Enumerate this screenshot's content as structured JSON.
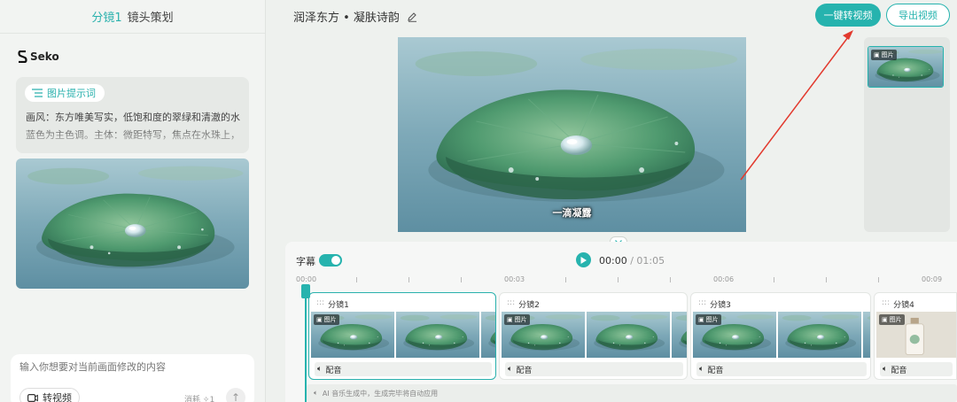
{
  "left_panel": {
    "header_accent": "分镜1",
    "header_title": "镜头策划",
    "brand_name": "Seko",
    "prompt_tag": "图片提示词",
    "prompt_text": "画风：东方唯美写实，低饱和度的翠绿和清澈的水蓝色为主色调。主体：微距特写，焦点在水珠上，悬荧",
    "input_placeholder": "输入你想要对当前画面修改的内容",
    "video_button": "转视频",
    "cost_label": "消耗",
    "cost_value": "1"
  },
  "header": {
    "title": "润泽东方 • 凝肤诗韵",
    "primary_button": "一键转视频",
    "secondary_button": "导出视频"
  },
  "preview": {
    "subtitle": "一滴凝露",
    "thumb_badge": "图片"
  },
  "timeline": {
    "subtitle_label": "字幕",
    "current_time": "00:00",
    "separator": "/",
    "total_time": "01:05",
    "ruler_labels": [
      "00:00",
      "00:03",
      "00:06",
      "00:09"
    ],
    "clips": [
      {
        "label": "分镜1",
        "badge": "图片",
        "audio": "配音"
      },
      {
        "label": "分镜2",
        "badge": "图片",
        "audio": "配音"
      },
      {
        "label": "分镜3",
        "badge": "图片",
        "audio": "配音"
      },
      {
        "label": "分镜4",
        "badge": "图片",
        "audio": "配音"
      }
    ],
    "music_text": "AI 音乐生成中，生成完毕将自动应用"
  },
  "colors": {
    "accent": "#26b3ae",
    "annotation_arrow": "#e23a2e"
  },
  "icons": {
    "edit": "pencil-icon",
    "prompt": "list-icon",
    "video": "video-camera-icon",
    "send": "arrow-up-icon",
    "play": "play-icon",
    "audio": "speaker-icon",
    "image_badge": "image-icon",
    "collapse": "chevron-down-icon"
  }
}
